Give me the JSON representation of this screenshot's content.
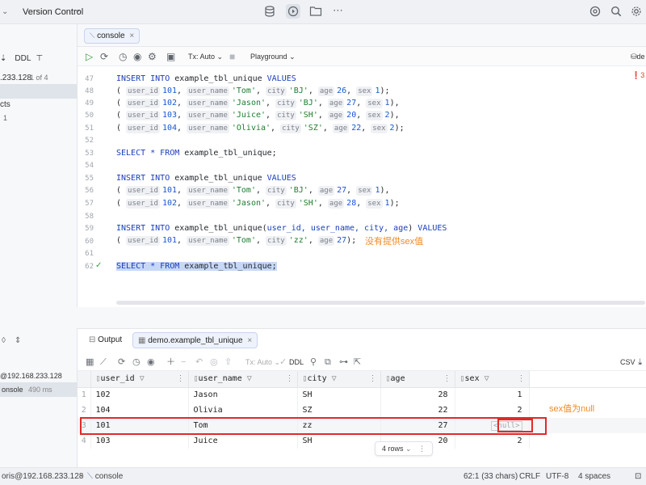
{
  "topbar": {
    "vcs_label": "Version Control"
  },
  "left_top": {
    "ddl": "DDL",
    "host": ".233.128",
    "page": "1 of 4",
    "row_cts": "cts",
    "row_1": "1"
  },
  "left_bottom": {
    "host": "@192.168.233.128",
    "console": "onsole",
    "console_time": "490 ms"
  },
  "editor": {
    "tab_label": "console",
    "tx_mode": "Tx: Auto",
    "playground": "Playground",
    "warn_count": "3",
    "de_label": "de",
    "lines": [
      47,
      48,
      49,
      50,
      51,
      52,
      53,
      54,
      55,
      56,
      57,
      58,
      59,
      60,
      61,
      62
    ],
    "code": {
      "l47": {
        "kw1": "INSERT INTO ",
        "ident": "example_tbl_unique ",
        "kw2": "VALUES"
      },
      "rows_a": [
        {
          "id": "101",
          "name": "'Tom'",
          "city": "'BJ'",
          "age": "26",
          "sex": "1",
          "end": ");"
        },
        {
          "id": "102",
          "name": "'Jason'",
          "city": "'BJ'",
          "age": "27",
          "sex": "1",
          "end": "),"
        },
        {
          "id": "103",
          "name": "'Juice'",
          "city": "'SH'",
          "age": "20",
          "sex": "2",
          "end": "),"
        },
        {
          "id": "104",
          "name": "'Olivia'",
          "city": "'SZ'",
          "age": "22",
          "sex": "2",
          "end": ");"
        }
      ],
      "select1": {
        "kw": "SELECT * FROM ",
        "ident": "example_tbl_unique;"
      },
      "l55": {
        "kw1": "INSERT INTO ",
        "ident": "example_tbl_unique ",
        "kw2": "VALUES"
      },
      "rows_b": [
        {
          "id": "101",
          "name": "'Tom'",
          "city": "'BJ'",
          "age": "27",
          "sex": "1",
          "end": "),"
        },
        {
          "id": "102",
          "name": "'Jason'",
          "city": "'SH'",
          "age": "28",
          "sex": "1",
          "end": ");"
        }
      ],
      "l59": {
        "kw1": "INSERT INTO ",
        "ident": "example_tbl_unique(",
        "cols": "user_id, user_name, city, age",
        "close": ") ",
        "kw2": "VALUES"
      },
      "row_c": {
        "id": "101",
        "name": "'Tom'",
        "city": "'zz'",
        "age": "27",
        "end": ");"
      },
      "select2": {
        "kw": "SELECT * FROM ",
        "ident": "example_tbl_unique;"
      },
      "hints": {
        "user_id": "user_id",
        "user_name": "user_name",
        "city": "city",
        "age": "age",
        "sex": "sex"
      }
    },
    "annotation": "没有提供sex值"
  },
  "bottom": {
    "tab_output": "Output",
    "tab_table": "demo.example_tbl_unique",
    "tx_mode": "Tx: Auto",
    "ddl": "DDL",
    "csv": "CSV",
    "columns": [
      "user_id",
      "user_name",
      "city",
      "age",
      "sex"
    ],
    "rows": [
      {
        "n": "1",
        "user_id": "102",
        "user_name": "Jason",
        "city": "SH",
        "age": "28",
        "sex": "1"
      },
      {
        "n": "2",
        "user_id": "104",
        "user_name": "Olivia",
        "city": "SZ",
        "age": "22",
        "sex": "2"
      },
      {
        "n": "3",
        "user_id": "101",
        "user_name": "Tom",
        "city": "zz",
        "age": "27",
        "sex": "<null>"
      },
      {
        "n": "4",
        "user_id": "103",
        "user_name": "Juice",
        "city": "SH",
        "age": "20",
        "sex": "2"
      }
    ],
    "rows_count": "4 rows",
    "annotation": "sex值为null",
    "highlight_color": "#e02a2a"
  },
  "statusbar": {
    "host": "oris@192.168.233.128",
    "sep": ">",
    "console": "console",
    "position": "62:1 (33 chars)",
    "eol": "CRLF",
    "encoding": "UTF-8",
    "indent": "4 spaces"
  }
}
